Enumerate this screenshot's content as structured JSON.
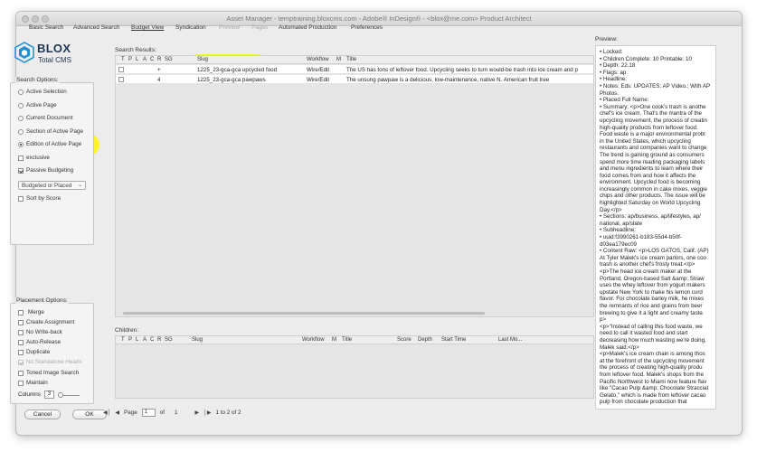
{
  "window": {
    "title": "Asset Manager - temptraining.bloxcms.com - Adobe® InDesign® - <blox@me.com> Product Architect"
  },
  "tabs": [
    {
      "label": "Basic Search",
      "state": "normal"
    },
    {
      "label": "Advanced Search",
      "state": "normal"
    },
    {
      "label": "Budget View",
      "state": "active"
    },
    {
      "label": "Syndication",
      "state": "normal"
    },
    {
      "label": "Preview",
      "state": "disabled"
    },
    {
      "label": "Pages",
      "state": "disabled"
    },
    {
      "label": "Automated Production",
      "state": "normal"
    },
    {
      "label": "Preferences",
      "state": "normal"
    }
  ],
  "logo": {
    "brand": "BLOX",
    "product": "Total CMS"
  },
  "search_options": {
    "title": "Search Options:",
    "radios": [
      {
        "label": "Active Selection",
        "selected": false
      },
      {
        "label": "Active Page",
        "selected": false
      },
      {
        "label": "Current Document",
        "selected": false
      },
      {
        "label": "Section of Active Page",
        "selected": false
      },
      {
        "label": "Edition of Active Page",
        "selected": true
      }
    ],
    "exclusive": {
      "label": "exclusive",
      "checked": false
    },
    "passive_budgeting": {
      "label": "Passive Budgeting",
      "checked": true
    },
    "budget_select": {
      "value": "Budgeted or Placed"
    },
    "sort_by_score": {
      "label": "Sort by Score",
      "checked": false
    }
  },
  "placement_options": {
    "title": "Placement Options:",
    "items": [
      {
        "label": "Merge",
        "checked": false,
        "disabled": false
      },
      {
        "label": "Create Assignment",
        "checked": false,
        "disabled": false
      },
      {
        "label": "No Write-back",
        "checked": false,
        "disabled": false
      },
      {
        "label": "Auto-Release",
        "checked": false,
        "disabled": false
      },
      {
        "label": "Duplicate",
        "checked": false,
        "disabled": false
      },
      {
        "label": "No Standalone Heads",
        "checked": true,
        "disabled": true
      },
      {
        "label": "Toned Image Search",
        "checked": false,
        "disabled": false
      },
      {
        "label": "Maintain",
        "checked": false,
        "disabled": false
      }
    ],
    "columns_label": "Columns",
    "columns_value": "3"
  },
  "search_results": {
    "title": "Search Results:",
    "headers": {
      "t": "T",
      "p": "P",
      "l": "L",
      "a": "A",
      "c": "C",
      "r": "R",
      "sg": "SG",
      "slug": "Slug",
      "workflow": "Workflow",
      "m": "M",
      "title": "Title"
    },
    "rows": [
      {
        "sg": "+",
        "slug": "1225_23-gca-gca upcycled food",
        "workflow": "Wire/Edit",
        "title": "The US has tons of leftover food. Upcycling seeks to turn would-be trash into ice cream and p"
      },
      {
        "sg": "4",
        "slug": "1225_23-gca-gca pawpaws",
        "workflow": "Wire/Edit",
        "title": "The unsung pawpaw is a delicious, low-maintenance, native N. American fruit tree"
      }
    ]
  },
  "children": {
    "title": "Children:",
    "headers": {
      "t": "T",
      "p": "P",
      "l": "L",
      "a": "A",
      "c": "C",
      "r": "R",
      "sg": "SG",
      "slug": "Slug",
      "workflow": "Workflow",
      "m": "M",
      "title": "Title",
      "score": "Score",
      "depth": "Depth",
      "start_time": "Start Time",
      "last_mod": "Last Mo..."
    }
  },
  "preview": {
    "title": "Preview:",
    "lines": [
      "• Locked:",
      "• Children Complete: 10 Printable: 10",
      "• Depth: 22.18",
      "• Flags: ap",
      "• Headline:",
      "• Notes: Eds: UPDATES: AP Video.; With AP",
      "Photos.",
      "• Placed Full Name:",
      "• Summary: <p>One cook's trash is anothe",
      "chef's ice cream. That's the mantra of the",
      "upcycling movement, the process of creatin",
      "high-quality products from leftover food.",
      "Food waste is a major environmental probl",
      "in the United States, which upcycling",
      "restaurants and companies want to change",
      "The trend is gaining ground as consumers",
      "spend more time reading packaging labels",
      "and menu ingredients to learn where their",
      "food comes from and how it affects the",
      "environment. Upcycled food is becoming",
      "increasingly common in cake mixes, veggie",
      "chips and other products. The issue will be",
      "highlighted Saturday on World Upcycling",
      "Day.</p>",
      "• Sections: ap/business, ap/lifestyles, ap/",
      "national, ap/state",
      "• Subheadline:",
      "• uuid:f3990261-b183-55d4-b50f-",
      "d03ea179ec09",
      "• Content Raw: <p>LOS GATOS, Calif. (AP)",
      "At Tyler Malek's ice cream parlors, one coo",
      "trash is another chef's frosty treat.</p>",
      "<p>The head ice cream maker at the",
      "Portland, Oregon-based Salt &amp; Straw",
      "uses the whey leftover from yogurt makers",
      "upstate New York to make his lemon curd",
      "flavor. For chocolate barley milk, he mixes",
      "the remnants of rice and grains from beer",
      "brewing to give it a light and creamy taste.",
      "p>",
      "<p>\"Instead of calling this food waste, we",
      "need to call it wasted food and start",
      "decreasing how much wasting we're doing,",
      "Malek said.</p>",
      "<p>Malek's ice cream chain is among thos",
      "at the forefront of the upcycling movement",
      "the process of creating high-quality produ",
      "from leftover food. Malek's shops from the",
      "Pacific Northwest to Miami now feature flav",
      "like \"Cacao Pulp &amp; Chocolate Stracciat",
      "Gelato,\" which is made from leftover cacao",
      "pulp from chocolate production that"
    ]
  },
  "footer": {
    "cancel_label": "Cancel",
    "ok_label": "OK",
    "page_label": "Page",
    "page_value": "1",
    "of_label": "of",
    "total_pages": "1",
    "range_text": "1 to 2 of 2"
  },
  "colors": {
    "highlight": "#fff500",
    "logo_blue": "#1f8fd6",
    "logo_navy": "#1f3552"
  }
}
